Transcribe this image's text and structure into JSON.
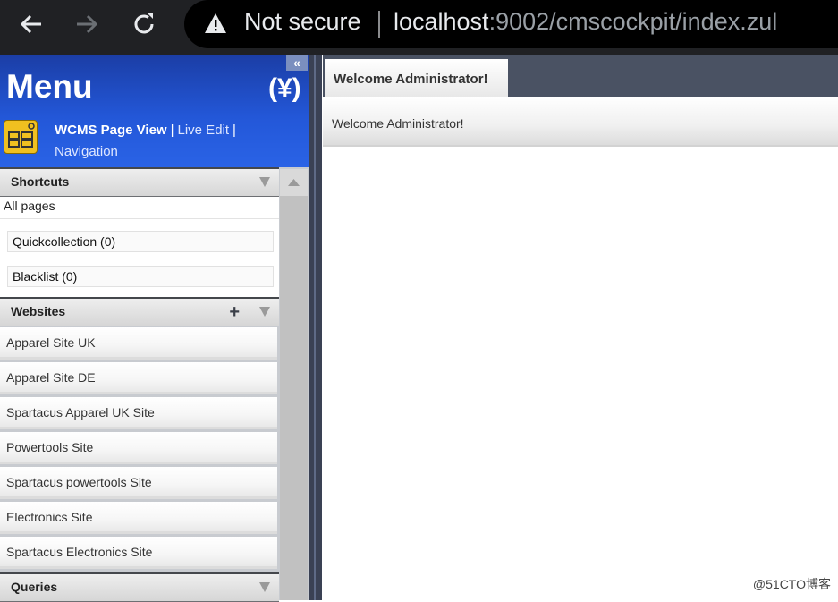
{
  "browser": {
    "security_label": "Not secure",
    "url_host": "localhost",
    "url_rest": ":9002/cmscockpit/index.zul"
  },
  "menu": {
    "title": "Menu",
    "collapse_label": "«",
    "logo_text": "(¥)",
    "nav": {
      "current": "WCMS Page View",
      "live_edit": "Live Edit",
      "navigation": "Navigation"
    }
  },
  "shortcuts": {
    "header": "Shortcuts",
    "all_pages": "All pages",
    "quickcollection": "Quickcollection (0)",
    "blacklist": "Blacklist (0)"
  },
  "websites": {
    "header": "Websites",
    "items": [
      {
        "label": "Apparel Site UK"
      },
      {
        "label": "Apparel Site DE"
      },
      {
        "label": "Spartacus Apparel UK Site"
      },
      {
        "label": "Powertools Site"
      },
      {
        "label": "Spartacus powertools Site"
      },
      {
        "label": "Electronics Site"
      },
      {
        "label": "Spartacus Electronics Site"
      }
    ]
  },
  "queries": {
    "header": "Queries"
  },
  "main": {
    "tab_label": "Welcome Administrator!",
    "welcome_text": "Welcome Administrator!"
  },
  "watermark": "@51CTO博客",
  "colors": {
    "menu_blue": "#2357d8",
    "tabbar": "#4a5263",
    "splitter": "#3a4154"
  }
}
